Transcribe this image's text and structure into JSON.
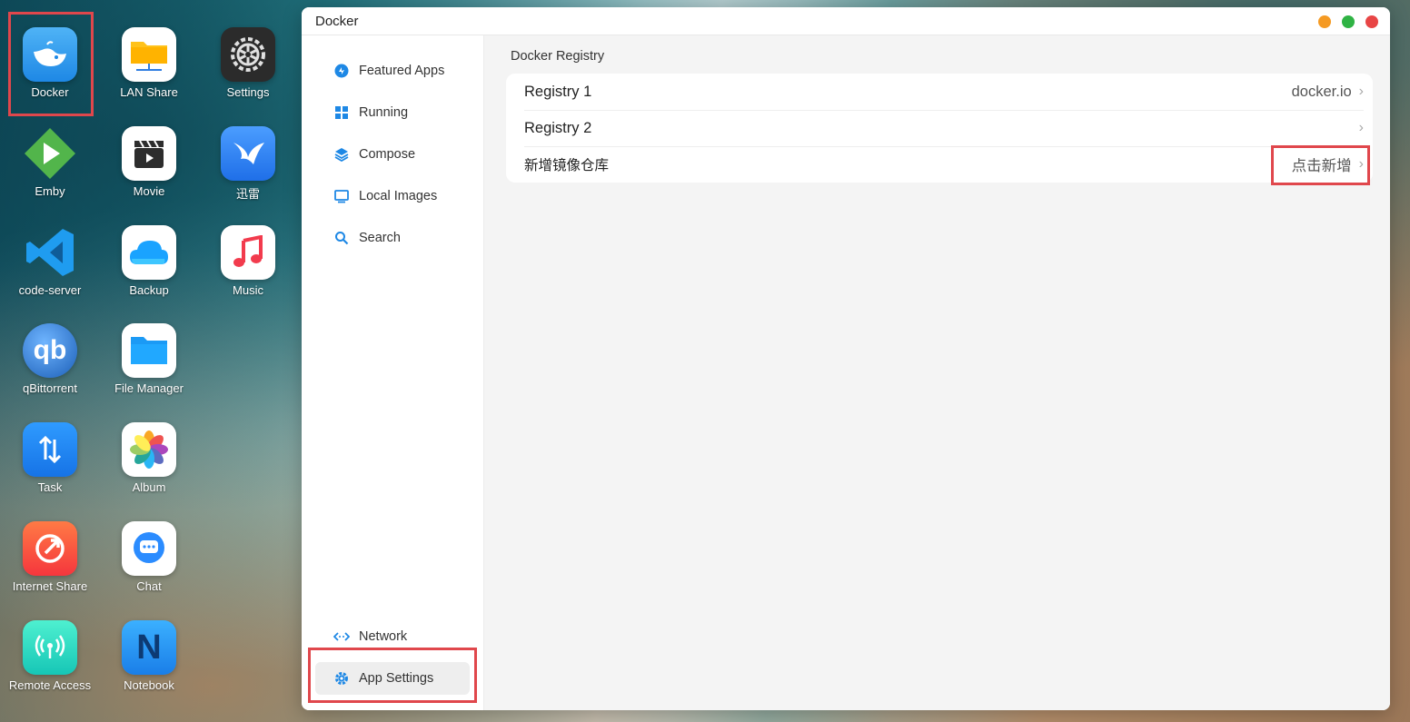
{
  "desktop": {
    "icons": [
      {
        "label": "Docker"
      },
      {
        "label": "LAN Share"
      },
      {
        "label": "Settings"
      },
      {
        "label": "Emby"
      },
      {
        "label": "Movie"
      },
      {
        "label": "迅雷"
      },
      {
        "label": "code-server"
      },
      {
        "label": "Backup"
      },
      {
        "label": "Music"
      },
      {
        "label": "qBittorrent"
      },
      {
        "label": "File Manager"
      },
      {
        "label": "Task"
      },
      {
        "label": "Album"
      },
      {
        "label": "Internet Share"
      },
      {
        "label": "Chat"
      },
      {
        "label": "Remote Access"
      },
      {
        "label": "Notebook"
      }
    ]
  },
  "window": {
    "title": "Docker",
    "controls": {
      "minimize_color": "#f59a23",
      "maximize_color": "#2fb344",
      "close_color": "#e84545"
    }
  },
  "sidebar": {
    "items": [
      {
        "label": "Featured Apps",
        "icon": "featured-icon"
      },
      {
        "label": "Running",
        "icon": "grid-icon"
      },
      {
        "label": "Compose",
        "icon": "layers-icon"
      },
      {
        "label": "Local Images",
        "icon": "monitor-icon"
      },
      {
        "label": "Search",
        "icon": "search-icon"
      }
    ],
    "bottom_items": [
      {
        "label": "Network",
        "icon": "network-icon"
      },
      {
        "label": "App Settings",
        "icon": "gear-icon",
        "active": true
      }
    ]
  },
  "main": {
    "section_title": "Docker Registry",
    "rows": [
      {
        "label": "Registry 1",
        "value": "docker.io"
      },
      {
        "label": "Registry 2",
        "value": ""
      },
      {
        "label": "新增镜像仓库",
        "value": "点击新增"
      }
    ]
  },
  "colors": {
    "accent": "#1e88e5",
    "highlight": "#e0474c"
  }
}
